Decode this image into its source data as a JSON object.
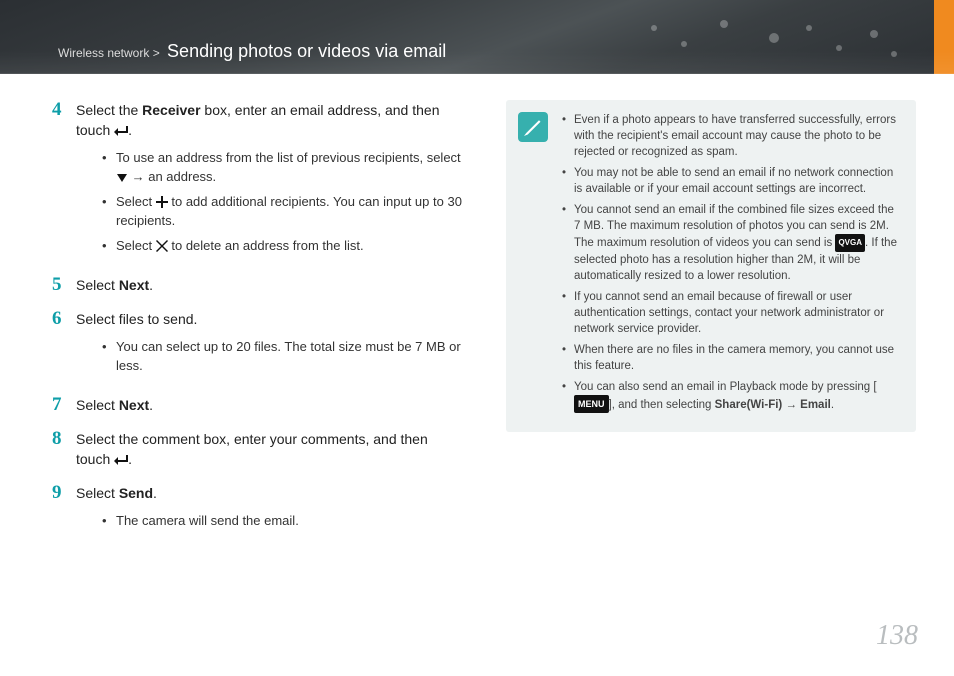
{
  "breadcrumb": {
    "category": "Wireless network",
    "sep": " > ",
    "section": "Sending photos or videos via email"
  },
  "steps": [
    {
      "n": "4",
      "html": "Select the <b>Receiver</b> box, enter an email address, and then touch {enter}.",
      "subs": [
        "To use an address from the list of previous recipients, select {down} → an address.",
        "Select {plus} to add additional recipients. You can input up to 30 recipients.",
        "Select {x} to delete an address from the list."
      ]
    },
    {
      "n": "5",
      "html": "Select <b>Next</b>."
    },
    {
      "n": "6",
      "html": "Select files to send.",
      "subs": [
        "You can select up to 20 files. The total size must be 7 MB or less."
      ]
    },
    {
      "n": "7",
      "html": "Select <b>Next</b>."
    },
    {
      "n": "8",
      "html": "Select the comment box, enter your comments, and then touch {enter}."
    },
    {
      "n": "9",
      "html": "Select <b>Send</b>.",
      "subs": [
        "The camera will send the email."
      ]
    }
  ],
  "callout": [
    "Even if a photo appears to have transferred successfully, errors with the recipient's email account may cause the photo to be rejected or recognized as spam.",
    "You may not be able to send an email if no network connection is available or if your email account settings are incorrect.",
    "You cannot send an email if the combined file sizes exceed the 7 MB. The maximum resolution of photos you can send is 2M. The maximum resolution of videos you can send is {vid}. If the selected photo has a resolution higher than 2M, it will be automatically resized to a lower resolution.",
    "If you cannot send an email because of firewall or user authentication settings, contact your network administrator or network service provider.",
    "When there are no files in the camera memory, you cannot use this feature.",
    "You can also send an email in Playback mode by pressing [{menu}], and then selecting <b>Share(Wi-Fi)</b> → <b>Email</b>."
  ],
  "icons": {
    "menu_label": "MENU",
    "vid_label": "QVGA"
  },
  "page_number": "138"
}
